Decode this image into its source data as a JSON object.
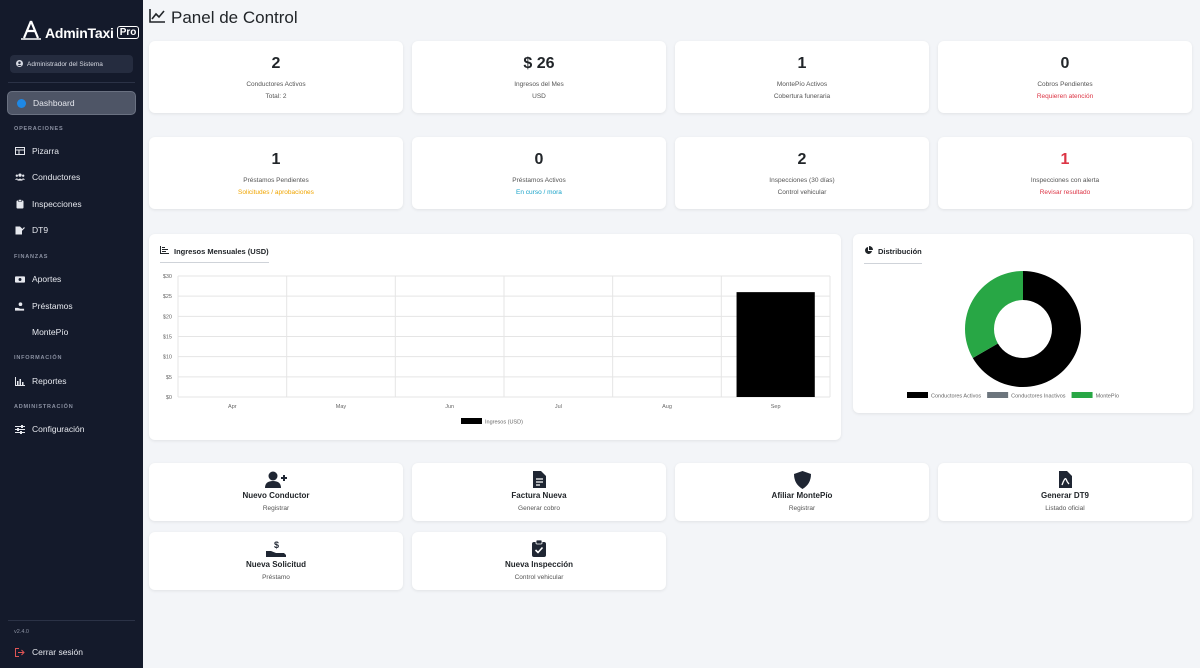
{
  "app": {
    "logo_text": "AdminTaxi",
    "logo_badge": "Pro",
    "user": "Administrador del Sistema",
    "version": "v2.4.0",
    "logout": "Cerrar sesión"
  },
  "sidebar": {
    "dashboard": "Dashboard",
    "sections": {
      "operaciones": "OPERACIONES",
      "finanzas": "FINANZAS",
      "informacion": "INFORMACIÓN",
      "administracion": "ADMINISTRACIÓN"
    },
    "items": {
      "pizarra": "Pizarra",
      "conductores": "Conductores",
      "inspecciones": "Inspecciones",
      "dt9": "DT9",
      "aportes": "Aportes",
      "prestamos": "Préstamos",
      "montepio": "MontePío",
      "reportes": "Reportes",
      "configuracion": "Configuración"
    }
  },
  "page_title": "Panel de Control",
  "stats": [
    {
      "value": "2",
      "label": "Conductores Activos",
      "sub": "Total: 2"
    },
    {
      "value": "$ 26",
      "label": "Ingresos del Mes",
      "sub": "USD"
    },
    {
      "value": "1",
      "label": "MontePío Activos",
      "sub": "Cobertura funeraria"
    },
    {
      "value": "0",
      "label": "Cobros Pendientes",
      "sub": "Requieren atención"
    },
    {
      "value": "1",
      "label": "Préstamos Pendientes",
      "sub": "Solicitudes / aprobaciones"
    },
    {
      "value": "0",
      "label": "Préstamos Activos",
      "sub": "En curso / mora"
    },
    {
      "value": "2",
      "label": "Inspecciones (30 días)",
      "sub": "Control vehicular"
    },
    {
      "value": "1",
      "label": "Inspecciones con alerta",
      "sub": "Revisar resultado"
    }
  ],
  "panels": {
    "income_title": "Ingresos Mensuales (USD)",
    "dist_title": "Distribución"
  },
  "chart_data": [
    {
      "type": "bar",
      "title": "Ingresos Mensuales (USD)",
      "categories": [
        "Apr",
        "May",
        "Jun",
        "Jul",
        "Aug",
        "Sep"
      ],
      "series": [
        {
          "name": "Ingresos (USD)",
          "values": [
            0,
            0,
            0,
            0,
            0,
            26
          ],
          "color": "#000000"
        }
      ],
      "ylim": [
        0,
        30
      ],
      "yticks": [
        "$0",
        "$5",
        "$10",
        "$15",
        "$20",
        "$25",
        "$30"
      ],
      "grid": true,
      "legend": "bottom"
    },
    {
      "type": "pie",
      "title": "Distribución",
      "donut": true,
      "labels": [
        "Conductores Activos",
        "Conductores Inactivos",
        "MontePío"
      ],
      "values": [
        2,
        0,
        1
      ],
      "colors": [
        "#000000",
        "#6c757d",
        "#28a745"
      ],
      "legend": "bottom"
    }
  ],
  "actions": [
    {
      "title": "Nuevo Conductor",
      "sub": "Registrar"
    },
    {
      "title": "Factura Nueva",
      "sub": "Generar cobro"
    },
    {
      "title": "Afiliar MontePío",
      "sub": "Registrar"
    },
    {
      "title": "Generar DT9",
      "sub": "Listado oficial"
    },
    {
      "title": "Nueva Solicitud",
      "sub": "Préstamo"
    },
    {
      "title": "Nueva Inspección",
      "sub": "Control vehicular"
    }
  ],
  "colors": {
    "sidebar_bg": "#141a2b",
    "accent_blue": "#1e88e5",
    "alert_red": "#dc3545",
    "warn_orange": "#f0a500",
    "info_cyan": "#17a2c8",
    "pie_green": "#28a745",
    "logout_red": "#e05555"
  }
}
